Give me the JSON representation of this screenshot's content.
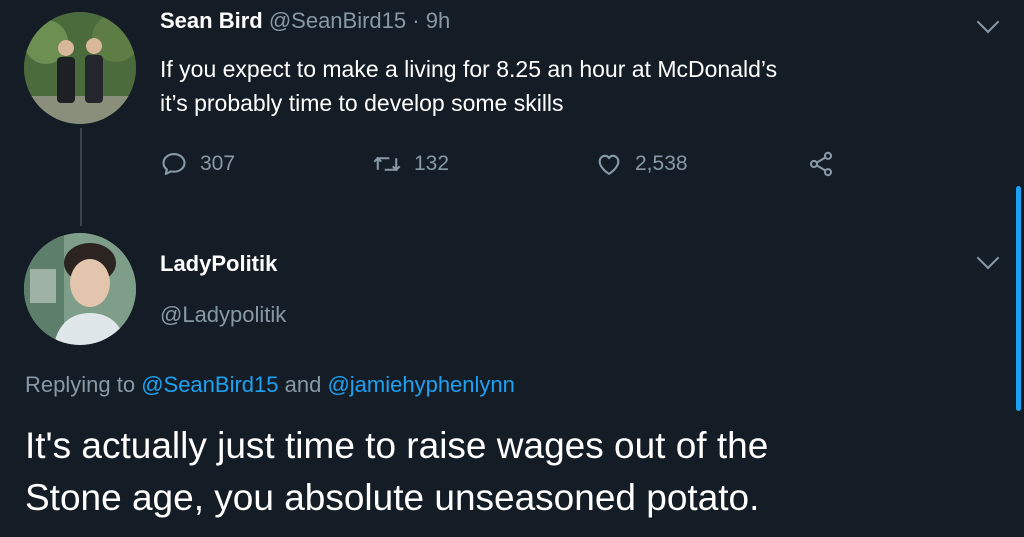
{
  "tweet1": {
    "display_name": "Sean Bird",
    "handle": "@SeanBird15",
    "separator": " · ",
    "time": "9h",
    "text_line1": "If you expect to make a living for 8.25 an hour at McDonald’s",
    "text_line2": "it’s probably time to develop some skills",
    "replies": "307",
    "retweets": "132",
    "likes": "2,538"
  },
  "tweet2": {
    "display_name": "LadyPolitik",
    "handle": "@Ladypolitik",
    "replying_prefix": "Replying to ",
    "mention1": "@SeanBird15",
    "replying_joiner": " and ",
    "mention2": "@jamiehyphenlynn",
    "text_line1": "It's actually just time to raise wages out of the",
    "text_line2": "Stone age, you absolute unseasoned potato."
  },
  "icons": {
    "reply": "reply-icon",
    "retweet": "retweet-icon",
    "like": "heart-icon",
    "share": "share-icon",
    "more": "chevron-down-icon"
  },
  "colors": {
    "background": "#141d26",
    "primary_text": "#ffffff",
    "secondary_text": "#8899a6",
    "accent": "#1da1f2"
  }
}
